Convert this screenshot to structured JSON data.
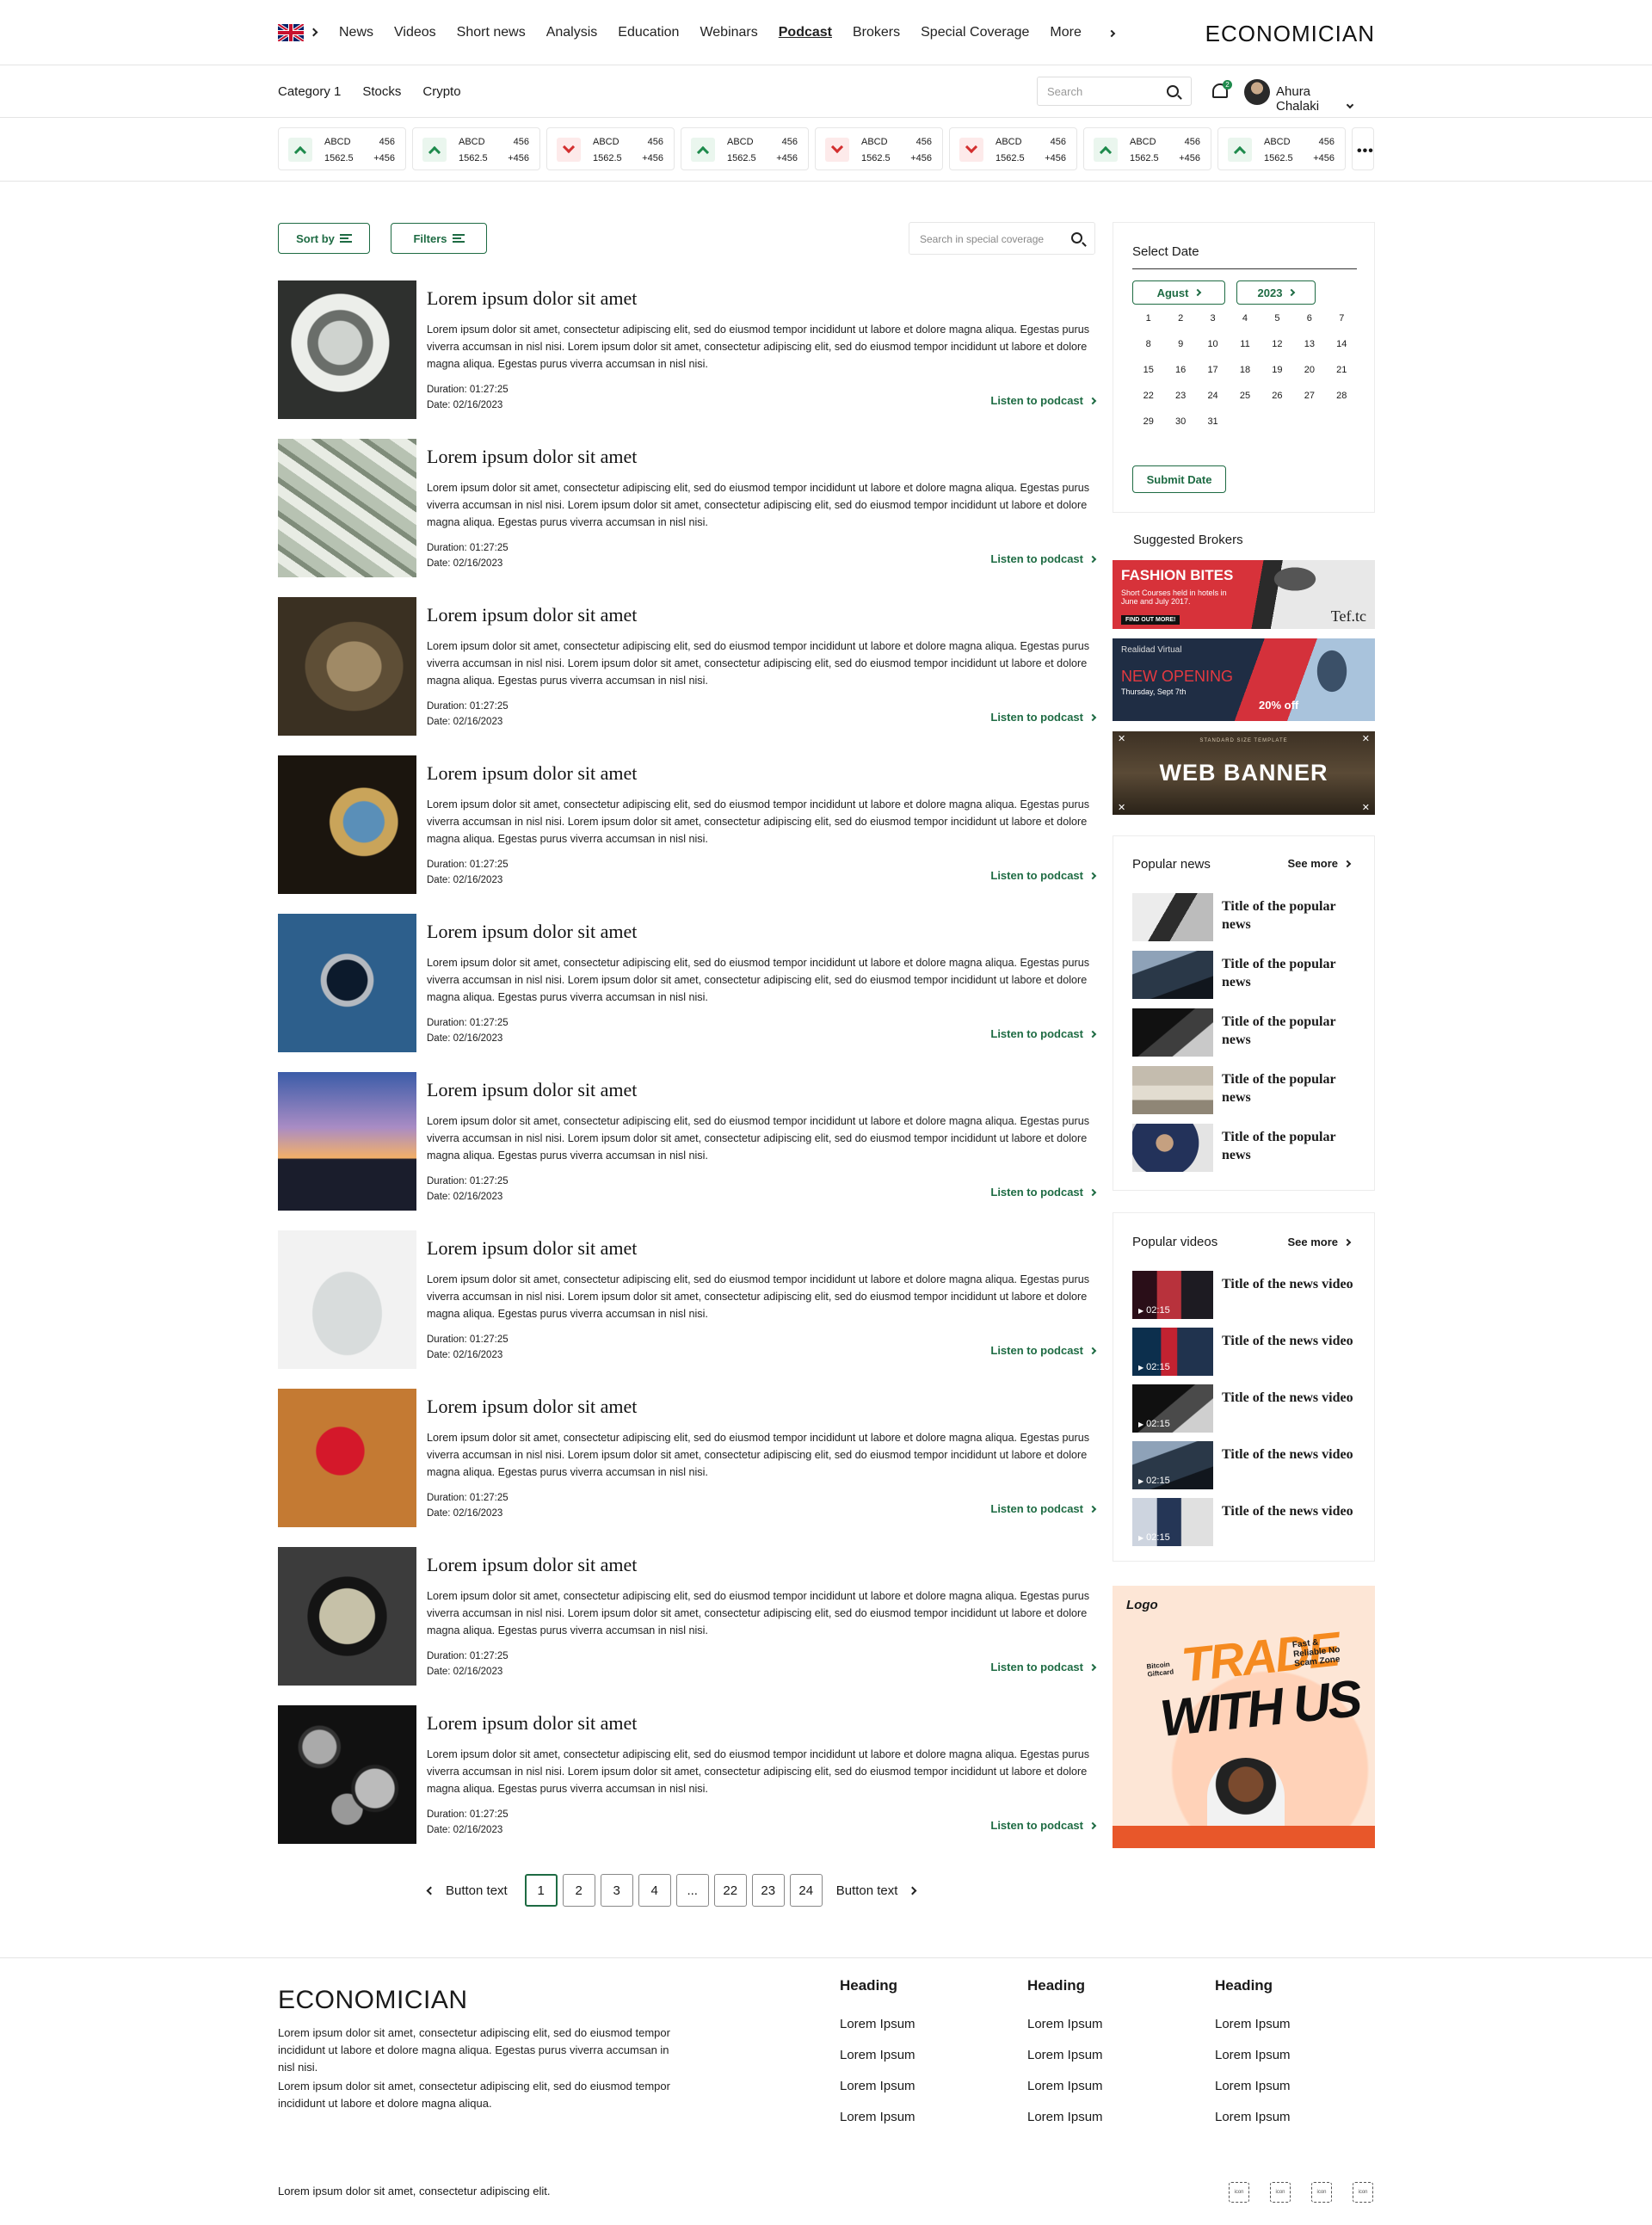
{
  "brand": "ECONOMICIAN",
  "nav": {
    "links": [
      "News",
      "Videos",
      "Short news",
      "Analysis",
      "Education",
      "Webinars",
      "Podcast",
      "Brokers",
      "Special Coverage"
    ],
    "active": "Podcast",
    "more": "More"
  },
  "subnav": {
    "links": [
      "Category 1",
      "Stocks",
      "Crypto"
    ],
    "search_placeholder": "Search",
    "notification_count": "2",
    "user_name": "Ahura Chalaki"
  },
  "ticker": [
    {
      "name": "ABCD",
      "qty": "456",
      "value": "1562.5",
      "change": "+456",
      "dir": "up"
    },
    {
      "name": "ABCD",
      "qty": "456",
      "value": "1562.5",
      "change": "+456",
      "dir": "up"
    },
    {
      "name": "ABCD",
      "qty": "456",
      "value": "1562.5",
      "change": "+456",
      "dir": "down"
    },
    {
      "name": "ABCD",
      "qty": "456",
      "value": "1562.5",
      "change": "+456",
      "dir": "up"
    },
    {
      "name": "ABCD",
      "qty": "456",
      "value": "1562.5",
      "change": "+456",
      "dir": "down"
    },
    {
      "name": "ABCD",
      "qty": "456",
      "value": "1562.5",
      "change": "+456",
      "dir": "down"
    },
    {
      "name": "ABCD",
      "qty": "456",
      "value": "1562.5",
      "change": "+456",
      "dir": "up"
    },
    {
      "name": "ABCD",
      "qty": "456",
      "value": "1562.5",
      "change": "+456",
      "dir": "up"
    }
  ],
  "controls": {
    "sort_label": "Sort by",
    "filters_label": "Filters",
    "search_placeholder": "Search in special coverage"
  },
  "podcasts": {
    "title": "Lorem ipsum dolor sit amet",
    "body": "Lorem ipsum dolor sit amet, consectetur adipiscing elit, sed do eiusmod tempor incididunt ut labore et dolore magna aliqua. Egestas purus viverra accumsan in nisl nisi. Lorem ipsum dolor sit amet, consectetur adipiscing elit, sed do eiusmod tempor incididunt ut labore et dolore magna aliqua. Egestas purus viverra accumsan in nisl nisi.",
    "duration": "Duration: 01:27:25",
    "date": "Date: 02/16/2023",
    "listen_label": "Listen to podcast",
    "thumbnails": [
      "banknote-mask",
      "dollar-bills",
      "benjamin-franklin",
      "globe",
      "compass",
      "city-skyline",
      "house-fund-jar",
      "piggy-bank",
      "wallet-cash",
      "coins"
    ]
  },
  "pagination": {
    "prev": "Button text",
    "next": "Button text",
    "pages": [
      "1",
      "2",
      "3",
      "4",
      "...",
      "22",
      "23",
      "24"
    ],
    "active": "1"
  },
  "calendar": {
    "title": "Select Date",
    "month": "Agust",
    "year": "2023",
    "days": [
      "1",
      "2",
      "3",
      "4",
      "5",
      "6",
      "7",
      "8",
      "9",
      "10",
      "11",
      "12",
      "13",
      "14",
      "15",
      "16",
      "17",
      "18",
      "19",
      "20",
      "21",
      "22",
      "23",
      "24",
      "25",
      "26",
      "27",
      "28",
      "29",
      "30",
      "31"
    ],
    "submit": "Submit Date"
  },
  "brokers": {
    "title": "Suggested Brokers",
    "banner1": {
      "title": "FASHION BITES",
      "text": "Short Courses held in hotels in June and July 2017.",
      "cta": "FIND OUT MORE!",
      "mark": "Tef.tc"
    },
    "banner2": {
      "kicker": "Realidad Virtual",
      "title": "NEW OPENING",
      "date": "Thursday, Sept 7th",
      "offer": "20% off"
    },
    "banner3": {
      "kicker": "STANDARD SIZE TEMPLATE",
      "title": "WEB BANNER"
    }
  },
  "popular_news": {
    "title": "Popular news",
    "see_more": "See more",
    "items": [
      "Title of the popular news",
      "Title of the popular news",
      "Title of the popular news",
      "Title of the popular news",
      "Title of the popular news"
    ]
  },
  "popular_videos": {
    "title": "Popular videos",
    "see_more": "See more",
    "duration": "02:15",
    "items": [
      "Title of the news video",
      "Title of the news video",
      "Title of the news video",
      "Title of the news video",
      "Title of the news video"
    ]
  },
  "ad": {
    "logo": "Logo",
    "headline1": "TRADE",
    "headline2": "WITH US",
    "side_text": "Fast & Reliable No Scam Zone",
    "badge": "Bitcoin Giftcard"
  },
  "footer": {
    "text1": "Lorem ipsum dolor sit amet, consectetur adipiscing elit, sed do eiusmod tempor incididunt ut labore et dolore magna aliqua. Egestas purus viverra accumsan in nisl nisi.",
    "text2": "Lorem ipsum dolor sit amet, consectetur adipiscing elit, sed do eiusmod tempor incididunt ut labore et dolore magna aliqua.",
    "columns": [
      {
        "heading": "Heading",
        "links": [
          "Lorem Ipsum",
          "Lorem Ipsum",
          "Lorem Ipsum",
          "Lorem Ipsum"
        ]
      },
      {
        "heading": "Heading",
        "links": [
          "Lorem Ipsum",
          "Lorem Ipsum",
          "Lorem Ipsum",
          "Lorem Ipsum"
        ]
      },
      {
        "heading": "Heading",
        "links": [
          "Lorem Ipsum",
          "Lorem Ipsum",
          "Lorem Ipsum",
          "Lorem Ipsum"
        ]
      }
    ],
    "copyright": "Lorem ipsum dolor sit amet, consectetur adipiscing elit.",
    "icon_label": "icon"
  },
  "colors": {
    "accent": "#1e6b43",
    "up": "#1e8a4c",
    "down": "#d32f2f"
  }
}
